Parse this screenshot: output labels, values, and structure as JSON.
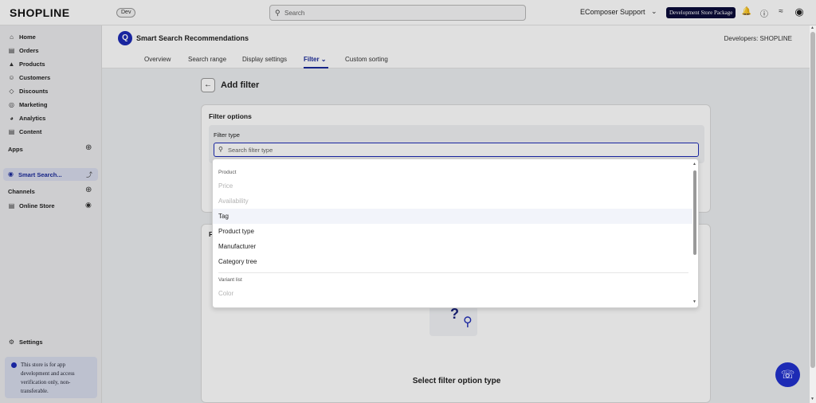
{
  "topbar": {
    "logo": "SHOPLINE",
    "env_badge": "Dev",
    "search_placeholder": "Search",
    "store_name": "EComposer Support",
    "package_badge": "Development Store Package"
  },
  "sidebar": {
    "items": [
      {
        "label": "Home",
        "icon": "home-icon"
      },
      {
        "label": "Orders",
        "icon": "orders-icon"
      },
      {
        "label": "Products",
        "icon": "products-icon"
      },
      {
        "label": "Customers",
        "icon": "customers-icon"
      },
      {
        "label": "Discounts",
        "icon": "discounts-icon"
      },
      {
        "label": "Marketing",
        "icon": "marketing-icon"
      },
      {
        "label": "Analytics",
        "icon": "analytics-icon"
      },
      {
        "label": "Content",
        "icon": "content-icon"
      }
    ],
    "apps_label": "Apps",
    "active_app": "Smart Search...",
    "channels_label": "Channels",
    "online_store": "Online Store",
    "settings": "Settings",
    "notice": "This store is for app development and access verification only, non-transferable."
  },
  "app": {
    "title": "Smart Search Recommendations",
    "developer": "Developers: SHOPLINE",
    "tabs": [
      "Overview",
      "Search range",
      "Display settings",
      "Filter",
      "Custom sorting"
    ],
    "active_tab": "Filter"
  },
  "page": {
    "title": "Add filter",
    "card_title": "Filter options",
    "filter_type_label": "Filter type",
    "filter_search_placeholder": "Search filter type",
    "card2_letter": "F",
    "empty_text": "Select filter option type"
  },
  "dropdown": {
    "group_product": "Product",
    "items": [
      {
        "label": "Price",
        "state": "disabled"
      },
      {
        "label": "Availability",
        "state": "disabled"
      },
      {
        "label": "Tag",
        "state": "hover"
      },
      {
        "label": "Product type",
        "state": "normal"
      },
      {
        "label": "Manufacturer",
        "state": "normal"
      },
      {
        "label": "Category tree",
        "state": "normal"
      }
    ],
    "group_variant": "Variant list",
    "variant_items": [
      {
        "label": "Color",
        "state": "disabled"
      }
    ]
  },
  "colors": {
    "accent": "#1d2bb5",
    "package_badge_bg": "#0b0c3a"
  }
}
